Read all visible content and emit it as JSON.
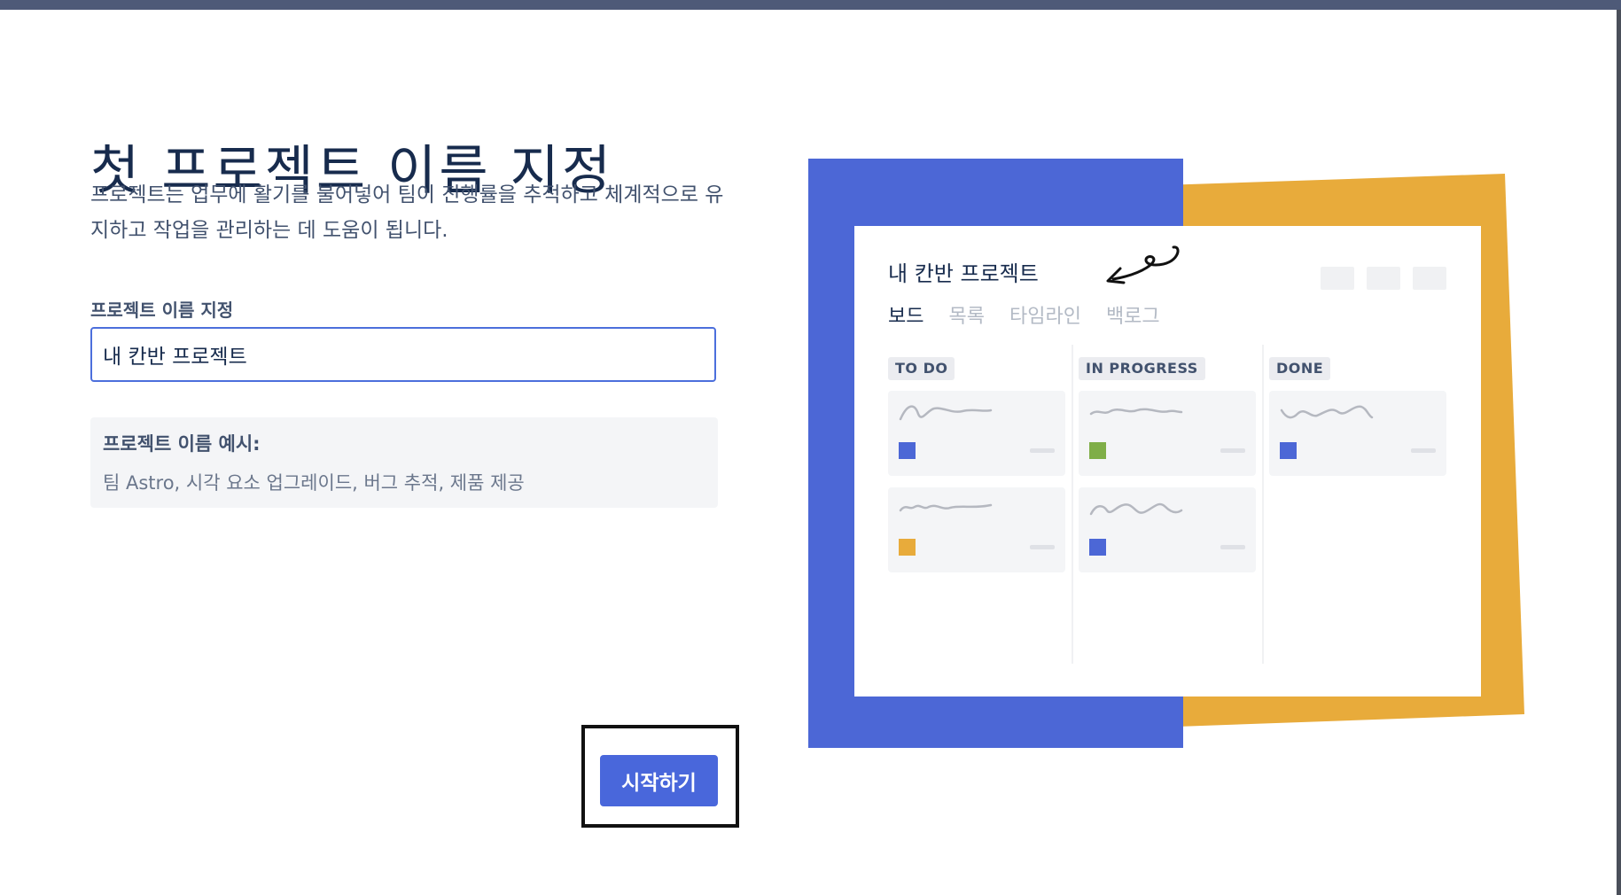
{
  "page": {
    "title": "첫 프로젝트 이름 지정",
    "description": "프로젝트는 업무에 활기를 불어넣어 팀이 진행률을 추적하고 체계적으로 유지하고 작업을 관리하는 데 도움이 됩니다."
  },
  "form": {
    "field_label": "프로젝트 이름 지정",
    "field_value": "내 칸반 프로젝트",
    "examples_title": "프로젝트 이름 예시:",
    "examples_text": "팀 Astro, 시각 요소 업그레이드, 버그 추적, 제품 제공",
    "start_label": "시작하기"
  },
  "preview": {
    "project_title": "내 칸반 프로젝트",
    "tabs": [
      "보드",
      "목록",
      "타임라인",
      "백로그"
    ],
    "active_tab": "보드",
    "columns": [
      {
        "name": "TO DO",
        "cards": [
          {
            "color": "#4c67d6"
          },
          {
            "color": "#e8ab3b"
          }
        ]
      },
      {
        "name": "IN PROGRESS",
        "cards": [
          {
            "color": "#7fae48"
          },
          {
            "color": "#4c67d6"
          }
        ]
      },
      {
        "name": "DONE",
        "cards": [
          {
            "color": "#4c67d6"
          }
        ]
      }
    ]
  },
  "colors": {
    "accent_blue": "#4967db",
    "illustration_blue": "#4c67d6",
    "illustration_navy": "#1f2d63",
    "illustration_orange": "#e8ab3b"
  }
}
